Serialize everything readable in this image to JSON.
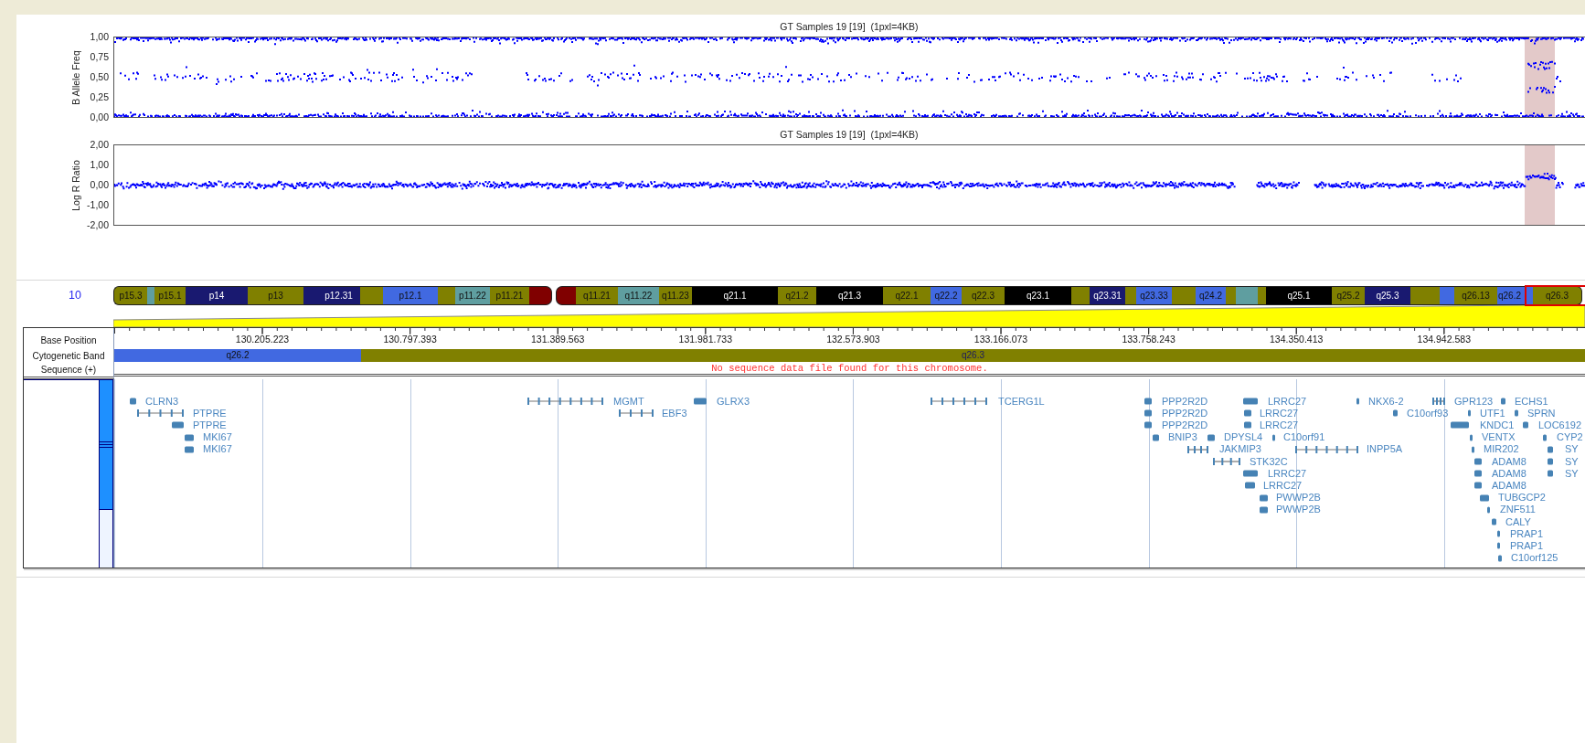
{
  "plots": [
    {
      "kind": "baf",
      "title": "GT Samples 19 [19]  (1pxl=4KB)",
      "ylabel": "B Allele Freq",
      "yticks": [
        "1,00",
        "0,75",
        "0,50",
        "0,25",
        "0,00"
      ]
    },
    {
      "kind": "lrr",
      "title": "GT Samples 19 [19]  (1pxl=4KB)",
      "ylabel": "Log R Ratio",
      "yticks": [
        "2,00",
        "1,00",
        "0,00",
        "-1,00",
        "-2,00"
      ]
    }
  ],
  "chromosome": {
    "label": "10",
    "bands": [
      {
        "label": "p15.3",
        "color": "#808000"
      },
      {
        "color": "#5f9ea0"
      },
      {
        "label": "p15.1",
        "color": "#808000"
      },
      {
        "label": "p14",
        "color": "#191970"
      },
      {
        "label": "p13",
        "color": "#808000"
      },
      {
        "color": "#191970"
      },
      {
        "label": "p12.31",
        "color": "#191970"
      },
      {
        "color": "#808000"
      },
      {
        "label": "p12.1",
        "color": "#4169e1"
      },
      {
        "color": "#808000"
      },
      {
        "label": "p11.22",
        "color": "#5f9ea0"
      },
      {
        "label": "p11.21",
        "color": "#808000"
      },
      {
        "color": "#800000"
      },
      {
        "color": "#800000"
      },
      {
        "label": "q11.21",
        "color": "#808000"
      },
      {
        "label": "q11.22",
        "color": "#5f9ea0"
      },
      {
        "label": "q11.23",
        "color": "#808000"
      },
      {
        "label": "q21.1",
        "color": "#000000"
      },
      {
        "label": "q21.2",
        "color": "#808000"
      },
      {
        "label": "q21.3",
        "color": "#000000"
      },
      {
        "label": "q22.1",
        "color": "#808000"
      },
      {
        "label": "q22.2",
        "color": "#4169e1"
      },
      {
        "label": "q22.3",
        "color": "#808000"
      },
      {
        "label": "q23.1",
        "color": "#000000"
      },
      {
        "color": "#808000"
      },
      {
        "label": "q23.31",
        "color": "#191970"
      },
      {
        "color": "#808000"
      },
      {
        "label": "q23.33",
        "color": "#4169e1"
      },
      {
        "color": "#808000"
      },
      {
        "label": "q24.2",
        "color": "#4169e1"
      },
      {
        "color": "#808000"
      },
      {
        "color": "#5f9ea0"
      },
      {
        "color": "#808000"
      },
      {
        "label": "q25.1",
        "color": "#000000"
      },
      {
        "label": "q25.2",
        "color": "#808000"
      },
      {
        "label": "q25.3",
        "color": "#191970"
      },
      {
        "color": "#808000"
      },
      {
        "color": "#4169e1"
      },
      {
        "label": "q26.13",
        "color": "#808000"
      },
      {
        "label": "q26.2",
        "color": "#4169e1"
      },
      {
        "label": "q26.3",
        "color": "#808000"
      }
    ]
  },
  "track": {
    "row_labels": [
      "Base Position",
      "Cytogenetic Band",
      "Sequence (+)"
    ],
    "positions": [
      "130.205.223",
      "130.797.393",
      "131.389.563",
      "131.981.733",
      "132.573.903",
      "133.166.073",
      "133.758.243",
      "134.350.413",
      "134.942.583"
    ],
    "cyto_bands": [
      {
        "label": "q26.2",
        "color": "#4169e1"
      },
      {
        "label": "q26.3",
        "color": "#808000"
      }
    ],
    "sequence_message": "No sequence data file found for this chromosome.",
    "genes": [
      {
        "name": "CLRN3"
      },
      {
        "name": "MGMT"
      },
      {
        "name": "GLRX3"
      },
      {
        "name": "TCERG1L"
      },
      {
        "name": "PPP2R2D"
      },
      {
        "name": "LRRC27"
      },
      {
        "name": "NKX6-2"
      },
      {
        "name": "GPR123"
      },
      {
        "name": "ECHS1"
      },
      {
        "name": "PTPRE"
      },
      {
        "name": "EBF3"
      },
      {
        "name": "PPP2R2D"
      },
      {
        "name": "LRRC27"
      },
      {
        "name": "C10orf93"
      },
      {
        "name": "UTF1"
      },
      {
        "name": "SPRN"
      },
      {
        "name": "PTPRE"
      },
      {
        "name": "PPP2R2D"
      },
      {
        "name": "LRRC27"
      },
      {
        "name": "KNDC1"
      },
      {
        "name": "LOC6192"
      },
      {
        "name": "MKI67"
      },
      {
        "name": "BNIP3"
      },
      {
        "name": "DPYSL4"
      },
      {
        "name": "C10orf91"
      },
      {
        "name": "VENTX"
      },
      {
        "name": "CYP2"
      },
      {
        "name": "MKI67"
      },
      {
        "name": "JAKMIP3"
      },
      {
        "name": "INPP5A"
      },
      {
        "name": "MIR202"
      },
      {
        "name": "SY"
      },
      {
        "name": "STK32C"
      },
      {
        "name": "ADAM8"
      },
      {
        "name": "SY"
      },
      {
        "name": "LRRC27"
      },
      {
        "name": "ADAM8"
      },
      {
        "name": "SY"
      },
      {
        "name": "LRRC27"
      },
      {
        "name": "ADAM8"
      },
      {
        "name": "PWWP2B"
      },
      {
        "name": "TUBGCP2"
      },
      {
        "name": "PWWP2B"
      },
      {
        "name": "ZNF511"
      },
      {
        "name": "CALY"
      },
      {
        "name": "PRAP1"
      },
      {
        "name": "PRAP1"
      },
      {
        "name": "C10orf125"
      }
    ]
  }
}
